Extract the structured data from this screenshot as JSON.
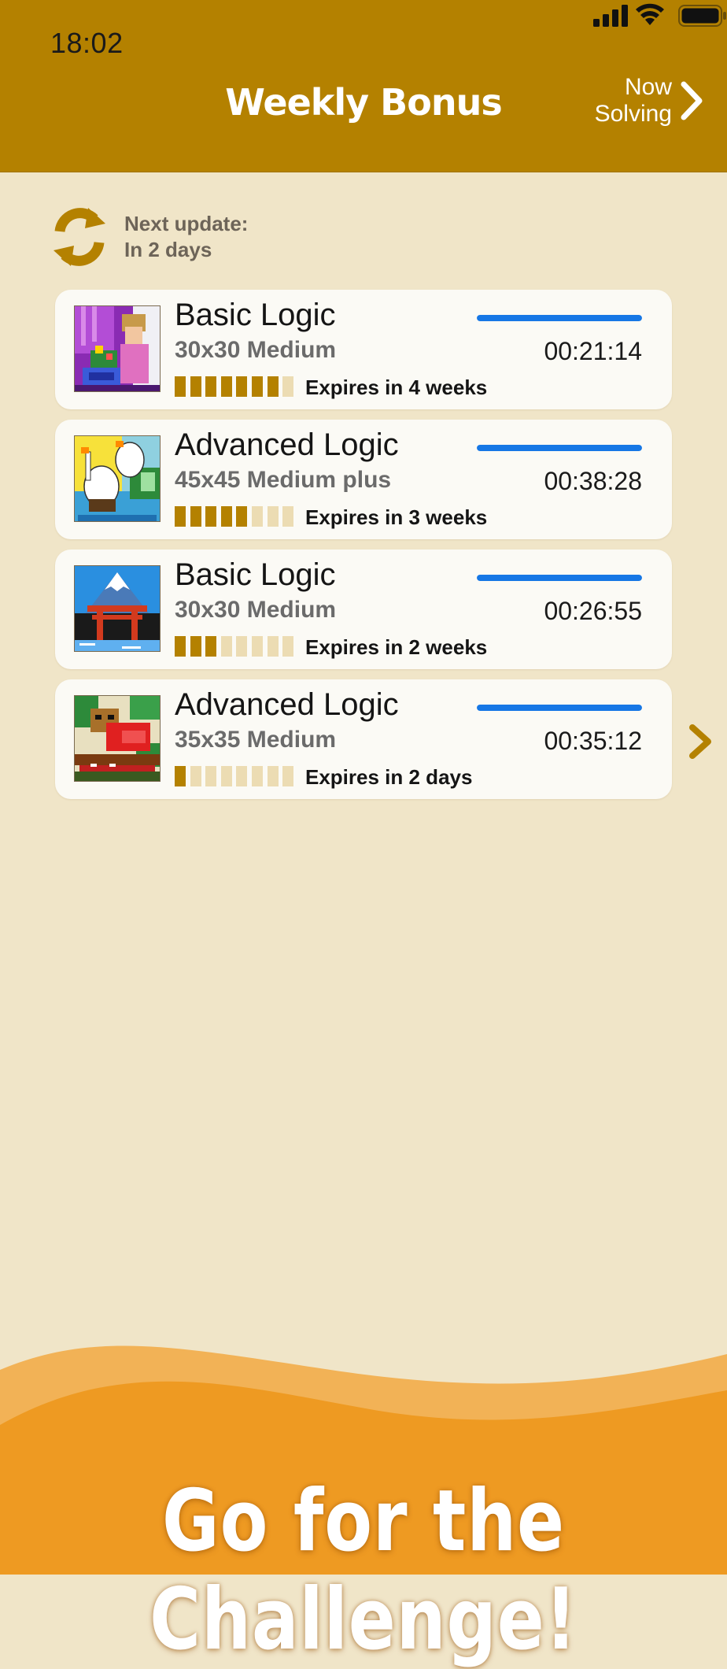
{
  "status_bar": {
    "time": "18:02",
    "icons": [
      "signal-icon",
      "wifi-icon",
      "battery-icon"
    ]
  },
  "header": {
    "title": "Weekly Bonus",
    "now_solving_line1": "Now",
    "now_solving_line2": "Solving",
    "now_solving_icon": "chevron-right-icon"
  },
  "update": {
    "icon": "refresh-icon",
    "label": "Next update:",
    "value": "In 2 days"
  },
  "puzzles": [
    {
      "name": "Basic Logic",
      "size": "30x30 Medium",
      "time": "00:21:14",
      "expires": "Expires in 4 weeks",
      "weeks_remaining": 7,
      "weeks_total": 8,
      "progress": 1.0,
      "thumb": "girl-with-flowers"
    },
    {
      "name": "Advanced Logic",
      "size": "45x45 Medium plus",
      "time": "00:38:28",
      "expires": "Expires in 3 weeks",
      "weeks_remaining": 5,
      "weeks_total": 8,
      "progress": 1.0,
      "thumb": "white-swans"
    },
    {
      "name": "Basic Logic",
      "size": "30x30 Medium",
      "time": "00:26:55",
      "expires": "Expires in 2 weeks",
      "weeks_remaining": 3,
      "weeks_total": 8,
      "progress": 1.0,
      "thumb": "mount-fuji-torii"
    },
    {
      "name": "Advanced Logic",
      "size": "35x35 Medium",
      "time": "00:35:12",
      "expires": "Expires in 2 days",
      "weeks_remaining": 1,
      "weeks_total": 8,
      "progress": 1.0,
      "thumb": "red-panda"
    }
  ],
  "next_icon": "chevron-right-icon",
  "footer": {
    "slogan": "Go for the Challenge!"
  },
  "colors": {
    "header": "#b48100",
    "background": "#f0e5c8",
    "accent_progress": "#1677e5",
    "block_on": "#b48100",
    "block_off": "#ecdcb3",
    "footer_orange": "#ee9a22"
  }
}
